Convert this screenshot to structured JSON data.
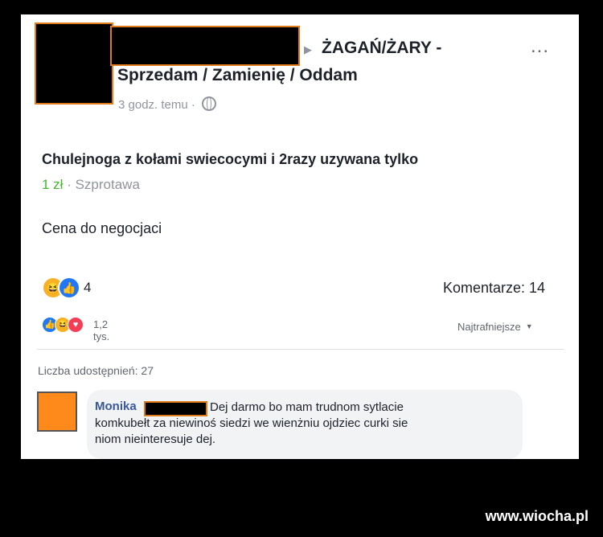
{
  "post": {
    "group_line1": "ŻAGAŃ/ŻARY -",
    "group_line2": "Sprzedam / Zamienię / Oddam",
    "time": "3 godz. temu ·",
    "more": "...",
    "title": "Chulejnoga z kołami swiecocymi i 2razy uzywana tylko",
    "price": "1 zł",
    "location": " · Szprotawa",
    "description": "Cena do negocjaci",
    "reaction_count": "4",
    "comments_label": "Komentarze: 14",
    "sub_reaction_count": "1,2 tys.",
    "sort_label": "Najtrafniejsze",
    "shares_label": "Liczba udostępnień: 27"
  },
  "comment": {
    "author": "Monika",
    "text_line1": "Dej darmo bo mam trudnom sytlacie",
    "text_line2": "komkubełt za niewinoś siedzi we wienżniu ojdziec curki sie",
    "text_line3": "niom nieinteresuje dej."
  },
  "icons": {
    "haha": "haha-icon",
    "like": "like-icon",
    "love": "love-icon",
    "globe": "globe-icon"
  },
  "colors": {
    "redaction_border": "#e07b1c",
    "price": "#42b72a",
    "author": "#385898",
    "like": "#2078f4",
    "love": "#f33e58",
    "haha": "#f7b125"
  },
  "watermark": "www.wiocha.pl"
}
